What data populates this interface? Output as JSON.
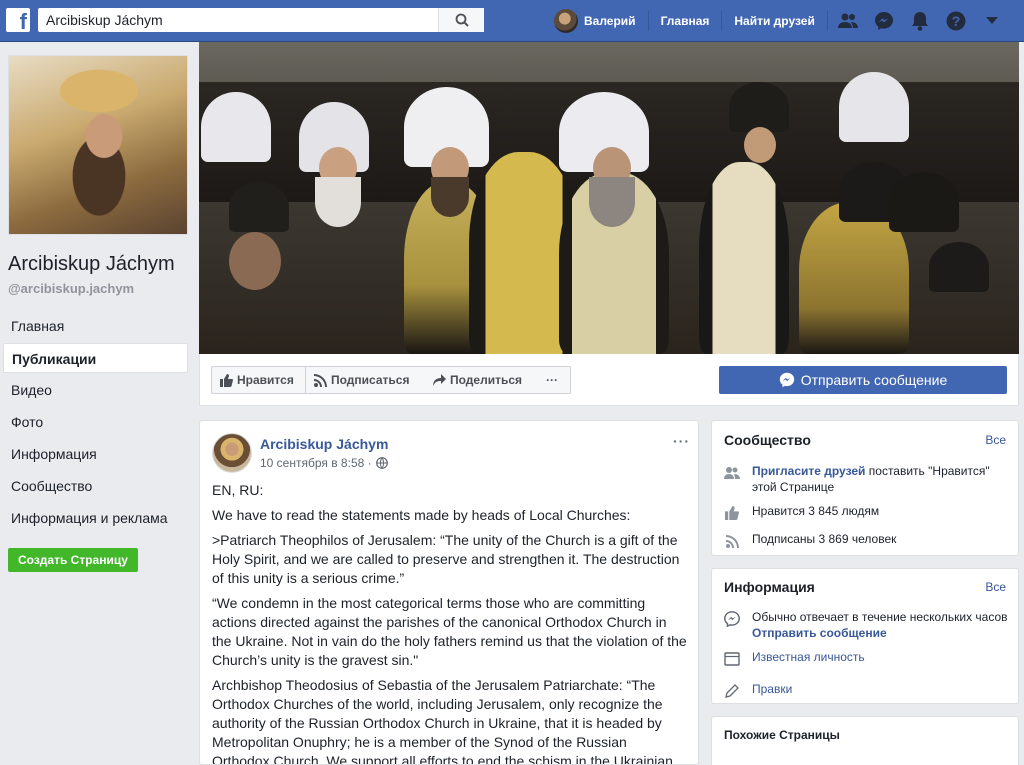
{
  "topbar": {
    "search_value": "Arcibiskup Jáchym",
    "user_name": "Валерий",
    "home": "Главная",
    "find_friends": "Найти друзей"
  },
  "left": {
    "page_name": "Arcibiskup Jáchym",
    "handle": "@arcibiskup.jachym",
    "nav": [
      {
        "label": "Главная"
      },
      {
        "label": "Публикации"
      },
      {
        "label": "Видео"
      },
      {
        "label": "Фото"
      },
      {
        "label": "Информация"
      },
      {
        "label": "Сообщество"
      },
      {
        "label": "Информация и реклама"
      }
    ],
    "create_page": "Создать Страницу"
  },
  "actions": {
    "like": "Нравится",
    "follow": "Подписаться",
    "share": "Поделиться",
    "more": "···",
    "send_message": "Отправить сообщение"
  },
  "post": {
    "author": "Arcibiskup Jáchym",
    "time": "10 сентября в 8:58 ·",
    "more": "···",
    "paragraphs": [
      "EN, RU:",
      "We have to read the statements made by heads of Local Churches:",
      ">Patriarch Theophilos of Jerusalem: “The unity of the Church is a gift of the Holy Spirit, and we are called to preserve and strengthen it. The destruction of this unity is a serious crime.”",
      "“We condemn in the most categorical terms those who are committing actions directed against the parishes of the canonical Orthodox Church in the Ukraine. Not in vain do the holy fathers remind us that the violation of the Church’s unity is the gravest sin.\"",
      "Archbishop Theodosius of Sebastia of the Jerusalem Patriarchate: “The Orthodox Churches of the world, including Jerusalem, only recognize the authority of the Russian Orthodox Church in Ukraine, that it is headed by Metropolitan Onuphry; he is a member of the Synod of the Russian Orthodox Church. We support all efforts to end the schism in the Ukrainian"
    ]
  },
  "community": {
    "title": "Сообщество",
    "see_all": "Все",
    "invite_link": "Пригласите друзей",
    "invite_rest": " поставить \"Нравится\" этой Странице",
    "likes": "Нравится 3 845 людям",
    "follows": "Подписаны 3 869 человек"
  },
  "about": {
    "title": "Информация",
    "see_all": "Все",
    "responds": "Обычно отвечает в течение нескольких часов",
    "send_message": "Отправить сообщение",
    "category": "Известная личность",
    "edits": "Правки"
  },
  "similar": {
    "title": "Похожие Страницы"
  },
  "colors": {
    "brand": "#4267b2",
    "link": "#385898",
    "green": "#42b72a"
  }
}
